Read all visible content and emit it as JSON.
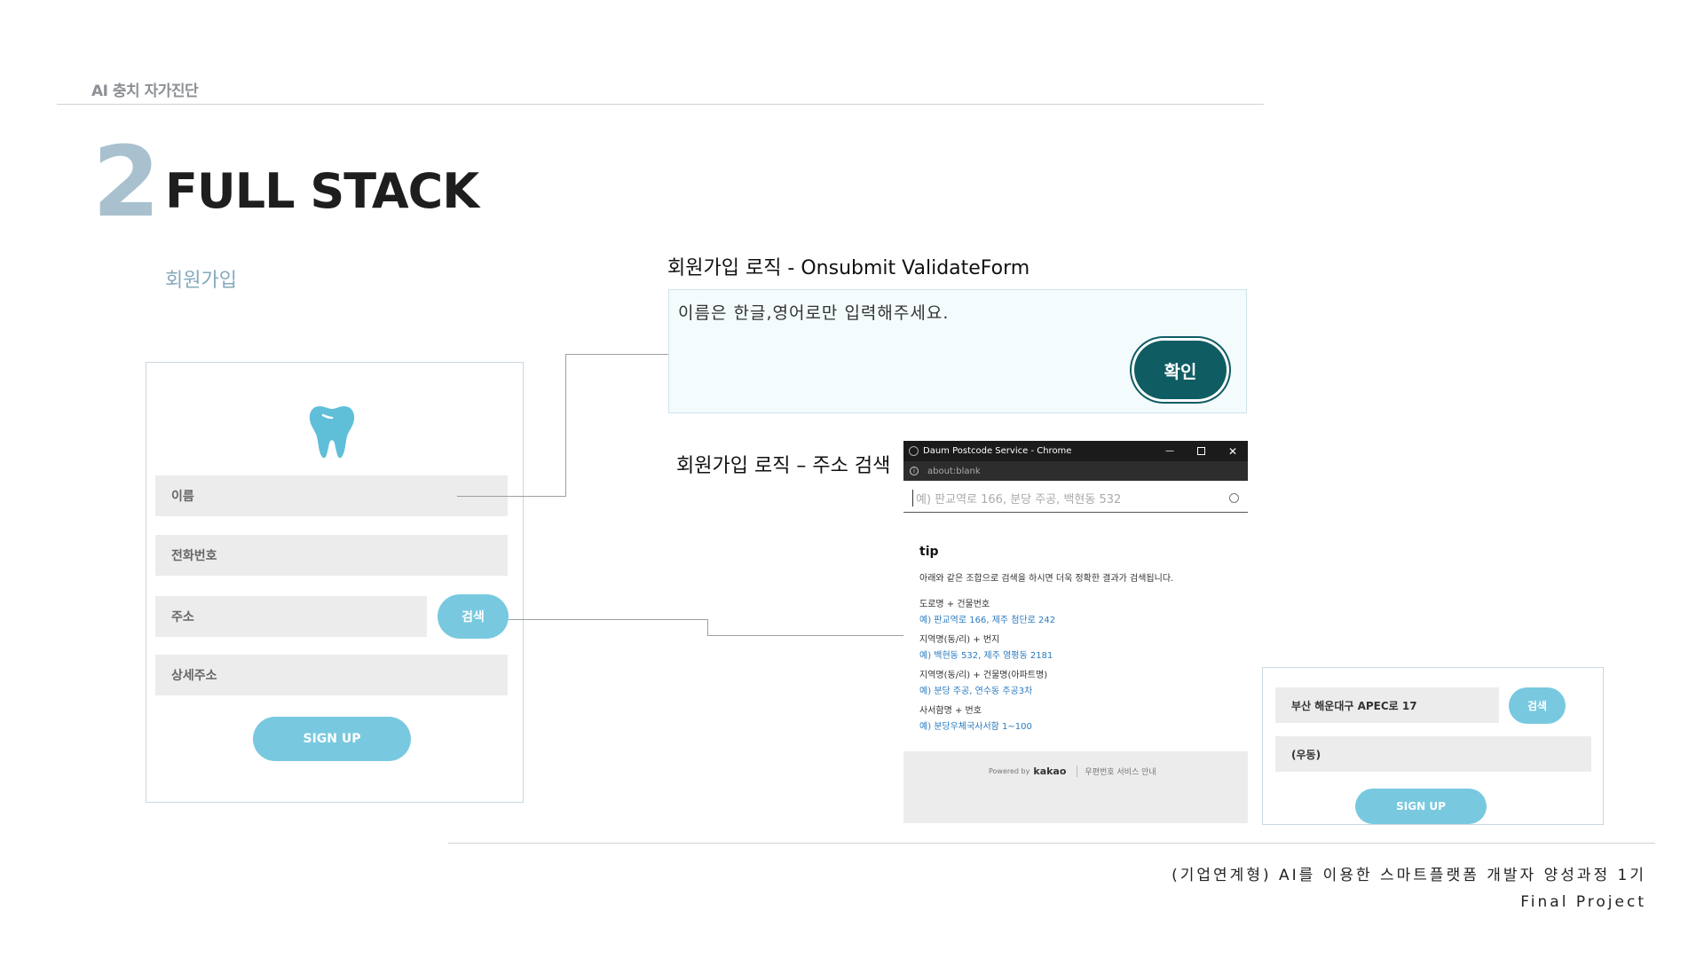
{
  "header": {
    "label": "AI 충치 자가진단"
  },
  "section": {
    "number": "2",
    "title": "FULL STACK",
    "subtitle": "회원가입"
  },
  "signup_form": {
    "name_placeholder": "이름",
    "phone_placeholder": "전화번호",
    "address_placeholder": "주소",
    "search_button": "검색",
    "detail_address_placeholder": "상세주소",
    "signup_button": "SIGN UP",
    "icon": "tooth-icon"
  },
  "validation": {
    "label": "회원가입 로직 - Onsubmit ValidateForm",
    "alert_text": "이름은 한글,영어로만 입력해주세요.",
    "confirm_button": "확인"
  },
  "postcode": {
    "label": "회원가입 로직 – 주소 검색",
    "window_title": "Daum Postcode Service - Chrome",
    "url": "about:blank",
    "search_placeholder": "예) 판교역로 166, 분당 주공, 백현동 532",
    "tip_title": "tip",
    "tip_desc": "아래와 같은 조합으로 검색을 하시면 더욱 정확한 결과가 검색됩니다.",
    "tips": [
      {
        "rule": "도로명 + 건물번호",
        "example": "예) 판교역로 166,  제주 첨단로 242"
      },
      {
        "rule": "지역명(동/리) + 번지",
        "example": "예) 백현동 532,  제주 영평동 2181"
      },
      {
        "rule": "지역명(동/리) + 건물명(아파트명)",
        "example": "예) 분당 주공,  연수동 주공3차"
      },
      {
        "rule": "사서함명 + 번호",
        "example": "예) 분당우체국사서함 1~100"
      }
    ],
    "footer_powered": "Powered by",
    "footer_brand": "kakao",
    "footer_link": "우편번호 서비스 안내"
  },
  "result_form": {
    "address_value": "부산 해운대구 APEC로 17",
    "search_button": "검색",
    "zip_value": "(우동)",
    "signup_button": "SIGN UP"
  },
  "footer": {
    "course": "(기업연계형) AI를 이용한 스마트플랫폼 개발자 양성과정 1기",
    "project": "Final Project"
  },
  "colors": {
    "accent": "#78c9df",
    "confirm": "#0f5c63",
    "number": "#a9c1cf"
  }
}
